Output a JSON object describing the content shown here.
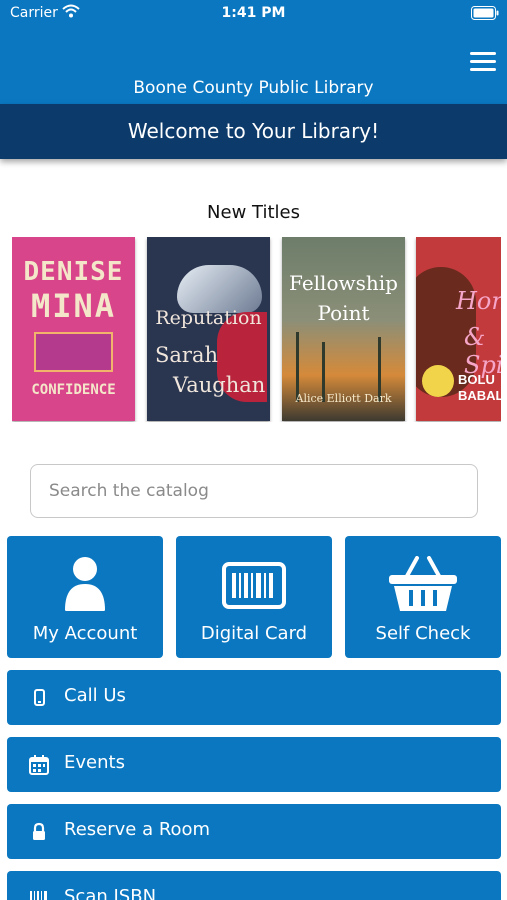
{
  "status_bar": {
    "carrier": "Carrier",
    "time": "1:41 PM",
    "wifi_icon": "wifi-icon",
    "battery_icon": "battery-icon"
  },
  "header": {
    "library_name": "Boone County Public Library",
    "menu_icon": "hamburger-menu-icon"
  },
  "welcome_banner": "Welcome to Your Library!",
  "new_titles": {
    "label": "New Titles",
    "books": [
      {
        "cover_lines": [
          "DENISE",
          "MINA",
          "CONFIDENCE"
        ],
        "color": "#d9458b"
      },
      {
        "cover_lines": [
          "Reputation",
          "Sarah",
          "Vaughan"
        ],
        "color": "#2a3550"
      },
      {
        "cover_lines": [
          "Fellowship",
          "Point",
          "Alice Elliott Dark"
        ],
        "color": "#8b8f78"
      },
      {
        "cover_lines": [
          "Hone",
          "& Spic",
          "BOLU BABALO"
        ],
        "color": "#c23a3c"
      }
    ]
  },
  "search": {
    "placeholder": "Search the catalog",
    "value": ""
  },
  "tiles": [
    {
      "label": "My Account",
      "icon": "user-icon"
    },
    {
      "label": "Digital Card",
      "icon": "barcode-card-icon"
    },
    {
      "label": "Self Check",
      "icon": "basket-icon"
    }
  ],
  "rows": [
    {
      "label": "Call Us",
      "icon": "phone-icon"
    },
    {
      "label": "Events",
      "icon": "calendar-icon"
    },
    {
      "label": "Reserve a Room",
      "icon": "lock-icon"
    },
    {
      "label": "Scan ISBN",
      "icon": "barcode-icon"
    }
  ],
  "colors": {
    "primary": "#0a77c0",
    "banner": "#0c3a6a",
    "background": "#ffffff"
  }
}
